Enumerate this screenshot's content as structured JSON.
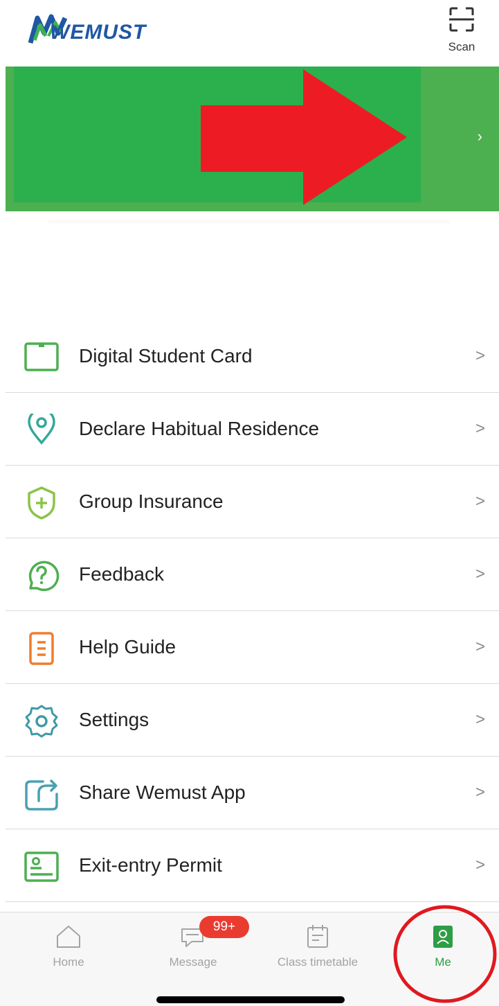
{
  "header": {
    "logo_text": "WEMUST",
    "scan_label": "Scan"
  },
  "banner": {
    "chevron": "›"
  },
  "menu": {
    "items": [
      {
        "label": "Digital Student Card",
        "icon": "card-icon",
        "color": "#4caf50"
      },
      {
        "label": "Declare Habitual Residence",
        "icon": "location-pin-icon",
        "color": "#33a89a"
      },
      {
        "label": "Group Insurance",
        "icon": "shield-plus-icon",
        "color": "#8bc34a"
      },
      {
        "label": "Feedback",
        "icon": "question-bubble-icon",
        "color": "#4caf50"
      },
      {
        "label": "Help Guide",
        "icon": "document-icon",
        "color": "#ef7d2e"
      },
      {
        "label": "Settings",
        "icon": "gear-icon",
        "color": "#3f9aa6"
      },
      {
        "label": "Share Wemust App",
        "icon": "share-icon",
        "color": "#4aa0b2"
      },
      {
        "label": "Exit-entry Permit",
        "icon": "id-card-icon",
        "color": "#4caf50"
      }
    ],
    "chevron": ">"
  },
  "tabbar": {
    "tabs": [
      {
        "label": "Home",
        "icon": "home-icon"
      },
      {
        "label": "Message",
        "icon": "chat-icon"
      },
      {
        "label": "Class timetable",
        "icon": "calendar-icon"
      },
      {
        "label": "Me",
        "icon": "person-icon"
      }
    ],
    "active": "Me",
    "message_badge": "99+",
    "active_color": "#2e9d44",
    "inactive_color": "#a3a3a3"
  }
}
